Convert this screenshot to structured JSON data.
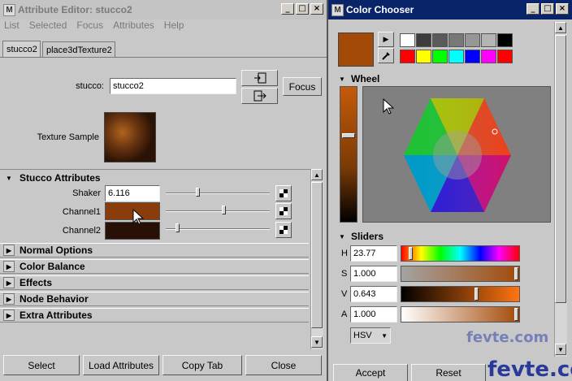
{
  "attribute_editor": {
    "title": "Attribute Editor: stucco2",
    "title_icon": "M",
    "menu": [
      "List",
      "Selected",
      "Focus",
      "Attributes",
      "Help"
    ],
    "tabs": [
      "stucco2",
      "place3dTexture2"
    ],
    "node_label": "stucco:",
    "node_value": "stucco2",
    "focus_label": "Focus",
    "texture_sample_label": "Texture Sample",
    "sections": {
      "stucco": "Stucco Attributes",
      "collapsed": [
        "Normal Options",
        "Color Balance",
        "Effects",
        "Node Behavior",
        "Extra Attributes"
      ]
    },
    "shaker_label": "Shaker",
    "shaker_value": "6.116",
    "channel1_label": "Channel1",
    "channel2_label": "Channel2",
    "buttons": [
      "Select",
      "Load Attributes",
      "Copy Tab",
      "Close"
    ],
    "colors": {
      "channel1": "#8a3c0a",
      "channel2": "#281006",
      "texture": "#6a3510"
    }
  },
  "color_chooser": {
    "title": "Color Chooser",
    "title_icon": "M",
    "current_color": "#a34a08",
    "palette": [
      "#ffffff",
      "#3c3c3c",
      "#5a5a5a",
      "#787878",
      "#969696",
      "#b4b4b4",
      "#000000",
      "#ff0000",
      "#ffff00",
      "#00ff00",
      "#00ffff",
      "#0000ff",
      "#ff00ff",
      "#ff0000"
    ],
    "wheel_label": "Wheel",
    "sliders_label": "Sliders",
    "h_label": "H",
    "h_value": "23.77",
    "s_label": "S",
    "s_value": "1.000",
    "v_label": "V",
    "v_value": "0.643",
    "a_label": "A",
    "a_value": "1.000",
    "mode": "HSV",
    "accept_label": "Accept",
    "reset_label": "Reset"
  },
  "watermark": {
    "text_top": "fevte.com",
    "text_bottom": "fevte.com"
  },
  "icons": [
    "maya-logo-icon",
    "minimize-icon",
    "maximize-icon",
    "close-icon",
    "load-texture-icon",
    "output-connection-icon",
    "expand-triangle-icon",
    "collapse-triangle-icon",
    "map-texture-icon",
    "eyedropper-icon",
    "arrow-right-icon",
    "cursor-icon"
  ]
}
